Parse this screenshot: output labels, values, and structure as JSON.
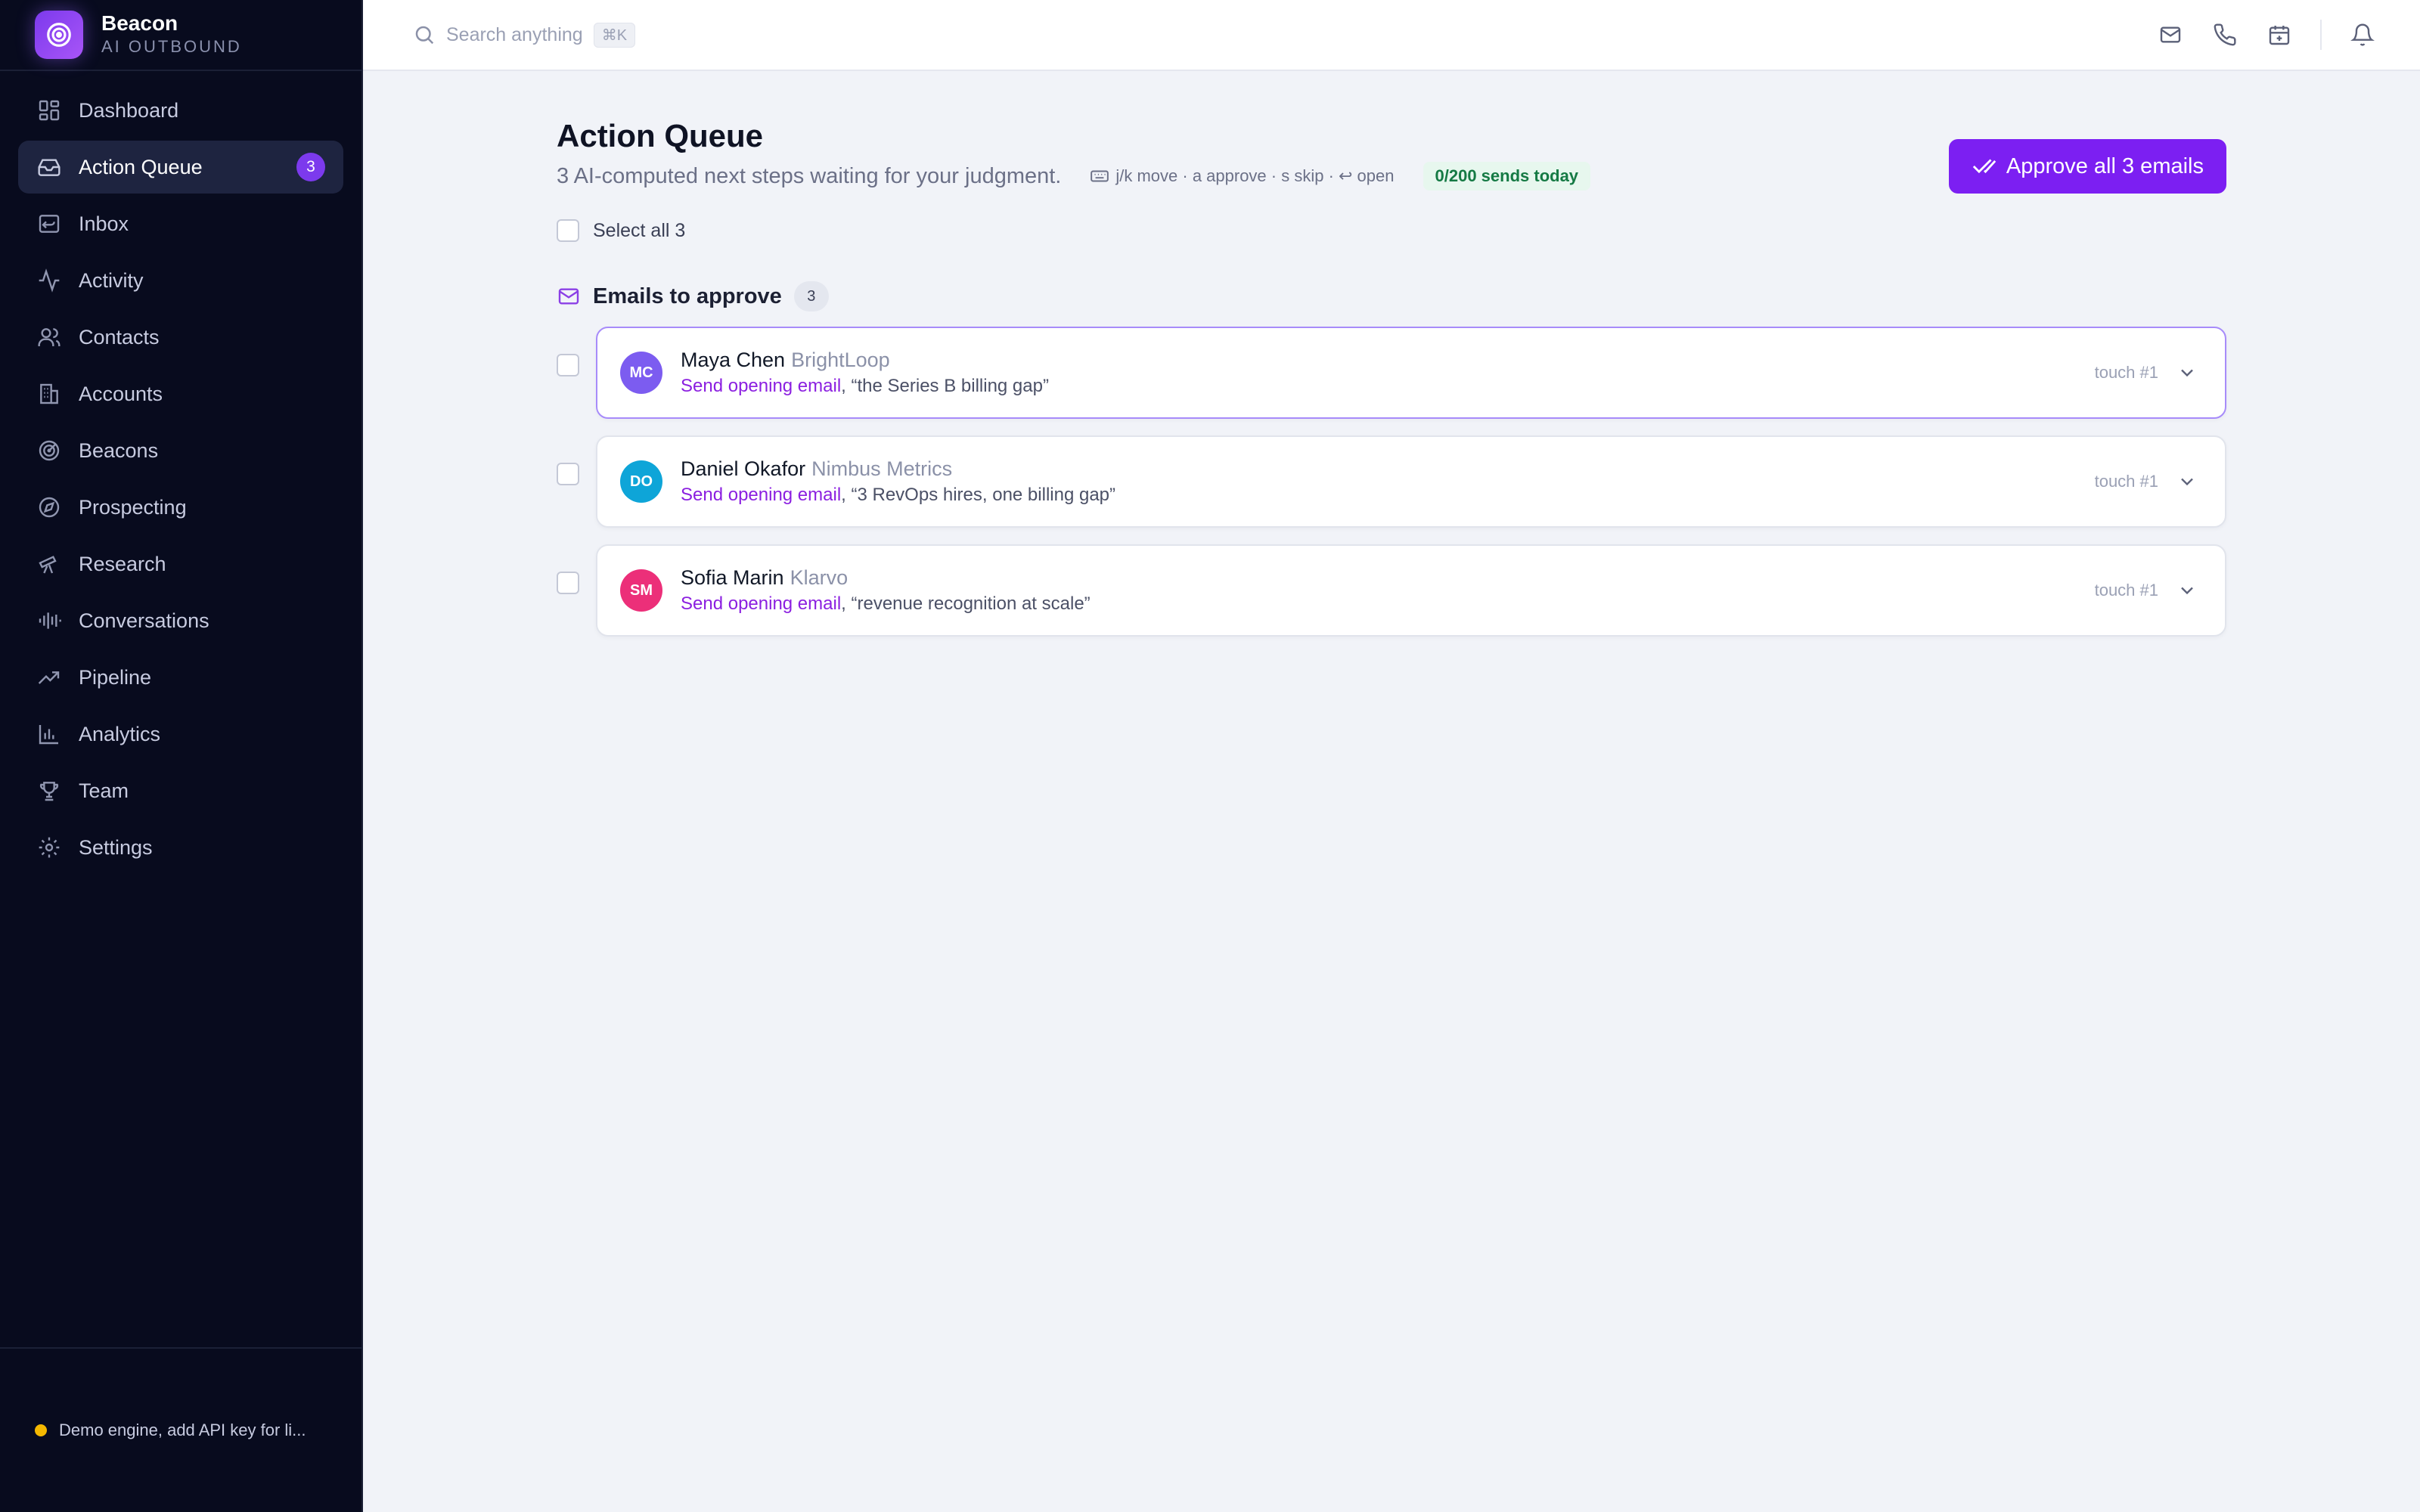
{
  "brand": {
    "name": "Beacon",
    "subtitle": "AI OUTBOUND"
  },
  "nav": [
    {
      "label": "Dashboard",
      "icon": "dashboard-icon"
    },
    {
      "label": "Action Queue",
      "icon": "inbox-tray-icon",
      "badge": "3",
      "active": true
    },
    {
      "label": "Inbox",
      "icon": "inbox-reply-icon"
    },
    {
      "label": "Activity",
      "icon": "activity-icon"
    },
    {
      "label": "Contacts",
      "icon": "users-icon"
    },
    {
      "label": "Accounts",
      "icon": "building-icon"
    },
    {
      "label": "Beacons",
      "icon": "radar-icon"
    },
    {
      "label": "Prospecting",
      "icon": "compass-icon"
    },
    {
      "label": "Research",
      "icon": "telescope-icon"
    },
    {
      "label": "Conversations",
      "icon": "audio-lines-icon"
    },
    {
      "label": "Pipeline",
      "icon": "trending-up-icon"
    },
    {
      "label": "Analytics",
      "icon": "bar-chart-icon"
    },
    {
      "label": "Team",
      "icon": "trophy-icon"
    },
    {
      "label": "Settings",
      "icon": "gear-icon"
    }
  ],
  "footer": {
    "status_text": "Demo engine, add API key for li...",
    "status_color": "#f5b800"
  },
  "topbar": {
    "search_placeholder": "Search anything",
    "search_shortcut": "⌘K"
  },
  "page": {
    "title": "Action Queue",
    "subtitle": "3 AI-computed next steps waiting for your judgment.",
    "shortcuts": "j/k move · a approve · s skip · ↩ open",
    "sends_today": "0/200 sends today",
    "approve_all_label": "Approve all 3 emails",
    "select_all_label": "Select all 3"
  },
  "section": {
    "title": "Emails to approve",
    "count": "3"
  },
  "rows": [
    {
      "initials": "MC",
      "avatar_color": "#7c5cf0",
      "name": "Maya Chen",
      "company": "BrightLoop",
      "action": "Send opening email",
      "detail": ", “the Series B billing gap”",
      "touch": "touch #1",
      "selected": true
    },
    {
      "initials": "DO",
      "avatar_color": "#0ea5d8",
      "name": "Daniel Okafor",
      "company": "Nimbus Metrics",
      "action": "Send opening email",
      "detail": ", “3 RevOps hires, one billing gap”",
      "touch": "touch #1",
      "selected": false
    },
    {
      "initials": "SM",
      "avatar_color": "#ec2f79",
      "name": "Sofia Marin",
      "company": "Klarvo",
      "action": "Send opening email",
      "detail": ", “revenue recognition at scale”",
      "touch": "touch #1",
      "selected": false
    }
  ],
  "colors": {
    "accent": "#7c1ff2",
    "sidebar_bg": "#080b1e",
    "page_bg": "#f1f3f8"
  }
}
